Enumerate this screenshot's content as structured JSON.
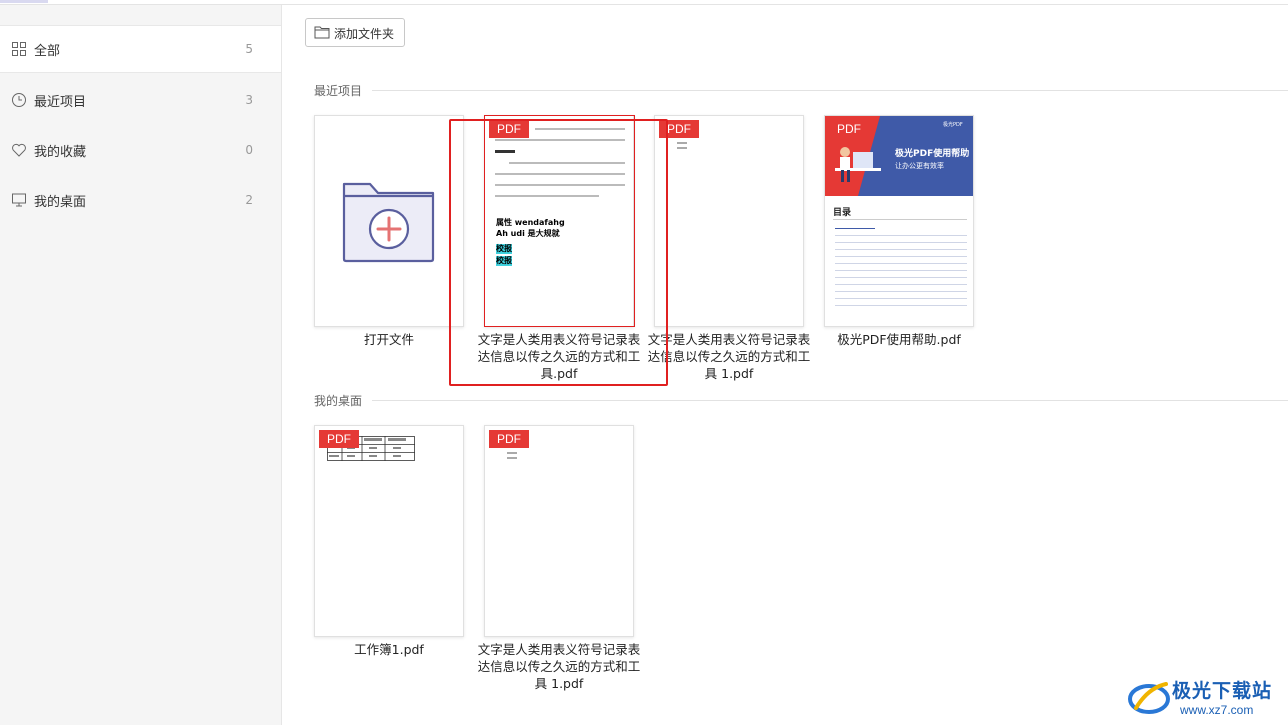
{
  "sidebar": {
    "items": [
      {
        "label": "全部",
        "count": "5",
        "icon": "grid-icon"
      },
      {
        "label": "最近项目",
        "count": "3",
        "icon": "clock-icon"
      },
      {
        "label": "我的收藏",
        "count": "0",
        "icon": "heart-icon"
      },
      {
        "label": "我的桌面",
        "count": "2",
        "icon": "monitor-icon"
      }
    ]
  },
  "toolbar": {
    "add_folder_label": "添加文件夹"
  },
  "recent": {
    "title": "最近项目",
    "files": [
      {
        "name": "打开文件"
      },
      {
        "name": "文字是人类用表义符号记录表达信息以传之久远的方式和工具.pdf",
        "badge": "PDF"
      },
      {
        "name": "文字是人类用表义符号记录表达信息以传之久远的方式和工具 1.pdf",
        "badge": "PDF"
      },
      {
        "name": "极光PDF使用帮助.pdf",
        "badge": "PDF"
      }
    ]
  },
  "desktop": {
    "title": "我的桌面",
    "files": [
      {
        "name": "工作簿1.pdf",
        "badge": "PDF"
      },
      {
        "name": "文字是人类用表义符号记录表达信息以传之久远的方式和工具 1.pdf",
        "badge": "PDF"
      }
    ]
  },
  "previews": {
    "doc1_heading1": "属性 wendafahg",
    "doc1_heading2": "Ah udi 是大规就",
    "doc1_hl1": "校报",
    "doc1_hl2": "校报",
    "help_title": "极光PDF使用帮助",
    "help_subtitle": "让办公更有效率",
    "help_toc": "目录",
    "help_brand": "极光PDF"
  },
  "watermark": {
    "text": "极光下载站",
    "url": "www.xz7.com"
  },
  "colors": {
    "pdf_badge": "#e53935",
    "highlight_box": "#e02020",
    "help_banner": "#3f5aa8"
  }
}
